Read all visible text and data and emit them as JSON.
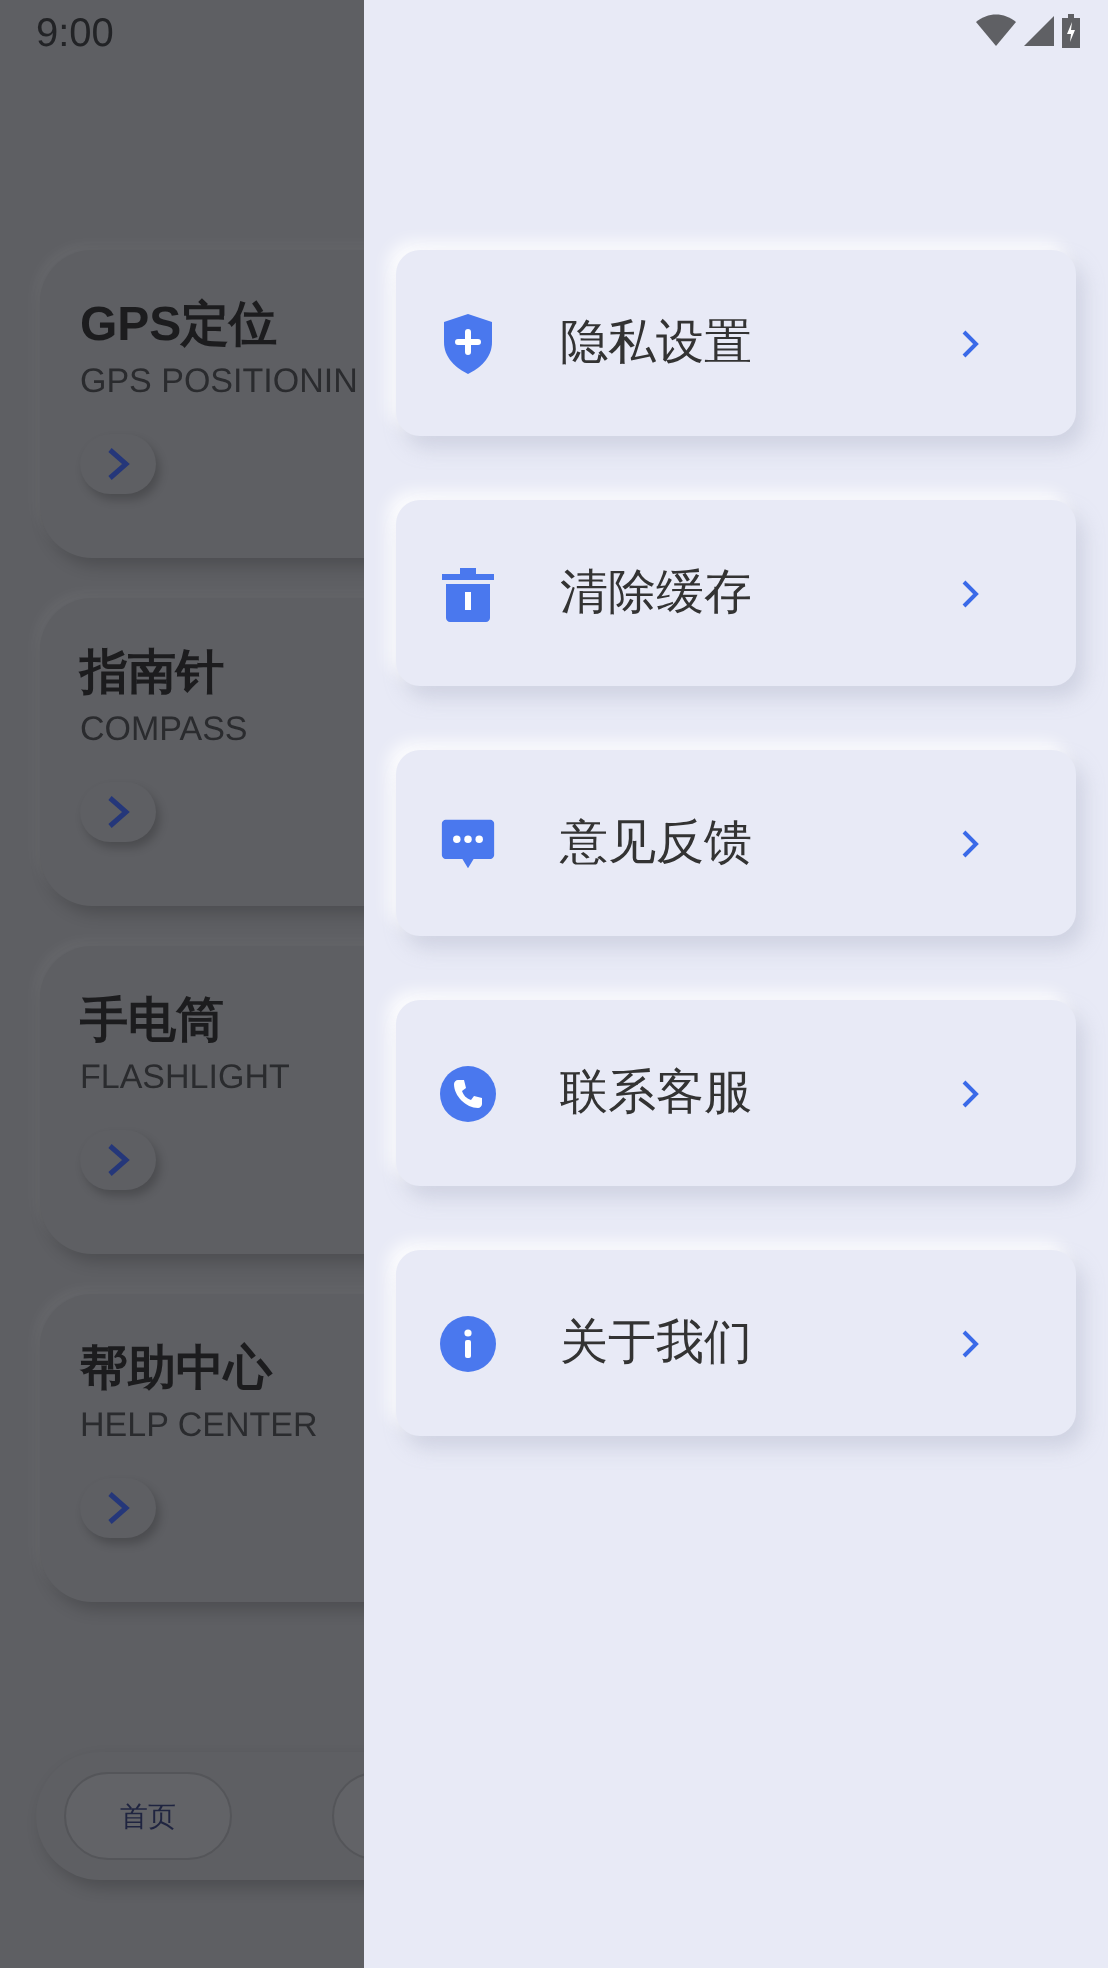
{
  "status_bar": {
    "time": "9:00"
  },
  "background_cards": [
    {
      "title": "GPS定位",
      "subtitle": "GPS POSITIONIN"
    },
    {
      "title": "指南针",
      "subtitle": "COMPASS"
    },
    {
      "title": "手电筒",
      "subtitle": "FLASHLIGHT"
    },
    {
      "title": "帮助中心",
      "subtitle": "HELP CENTER"
    }
  ],
  "bottom_nav": {
    "tabs": [
      {
        "label": "首页"
      }
    ]
  },
  "menu": [
    {
      "kind": "shield",
      "label": "隐私设置"
    },
    {
      "kind": "trash",
      "label": "清除缓存"
    },
    {
      "kind": "chat",
      "label": "意见反馈"
    },
    {
      "kind": "phone",
      "label": "联系客服"
    },
    {
      "kind": "info",
      "label": "关于我们"
    }
  ]
}
